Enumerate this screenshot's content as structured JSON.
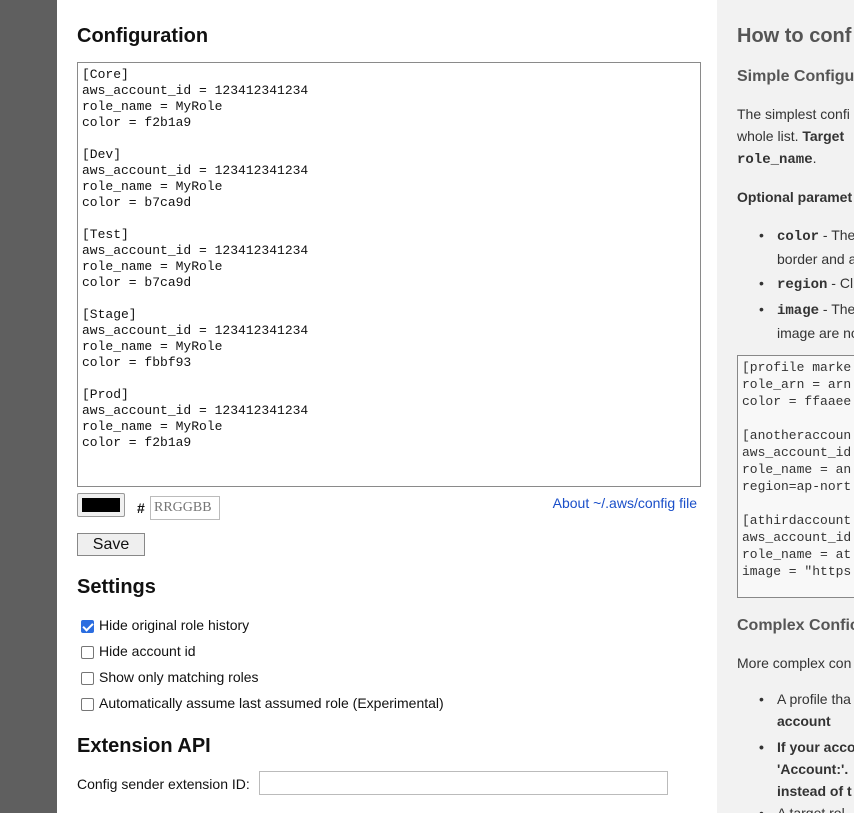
{
  "config": {
    "heading": "Configuration",
    "text": "[Core]\naws_account_id = 123412341234\nrole_name = MyRole\ncolor = f2b1a9\n\n[Dev]\naws_account_id = 123412341234\nrole_name = MyRole\ncolor = b7ca9d\n\n[Test]\naws_account_id = 123412341234\nrole_name = MyRole\ncolor = b7ca9d\n\n[Stage]\naws_account_id = 123412341234\nrole_name = MyRole\ncolor = fbbf93\n\n[Prod]\naws_account_id = 123412341234\nrole_name = MyRole\ncolor = f2b1a9",
    "color_value": "#000000",
    "hash": "#",
    "hex_placeholder": "RRGGBB",
    "about_link": "About ~/.aws/config file",
    "save_label": "Save"
  },
  "settings": {
    "heading": "Settings",
    "items": [
      {
        "label": "Hide original role history",
        "checked": true
      },
      {
        "label": "Hide account id",
        "checked": false
      },
      {
        "label": "Show only matching roles",
        "checked": false
      },
      {
        "label": "Automatically assume last assumed role (Experimental)",
        "checked": false
      }
    ]
  },
  "api": {
    "heading": "Extension API",
    "sender_label": "Config sender extension ID:"
  },
  "help": {
    "heading": "How to conf",
    "simple_heading": "Simple Configu",
    "simple_p_line1": "The simplest confi",
    "simple_p_line2_a": "whole list.",
    "simple_p_line2_b": "Target",
    "simple_p_line3_code": "role_name",
    "simple_p_line3_end": ".",
    "optional_heading": "Optional paramet",
    "optional_items": [
      {
        "code": "color",
        "text": " - The",
        "line2": "border and a"
      },
      {
        "code": "region",
        "text": " - Cl"
      },
      {
        "code": "image",
        "text": " - The",
        "line2": "image are no"
      }
    ],
    "example_code": "[profile marke\nrole_arn = arn\ncolor = ffaaee\n\n[anotheraccoun\naws_account_id\nrole_name = an\nregion=ap-nort\n\n[athirdaccount\naws_account_id\nrole_name = at\nimage = \"https",
    "complex_heading": "Complex Confic",
    "complex_p": "More complex con",
    "complex_items": [
      {
        "line1": "A profile tha",
        "line2_bold": "account"
      },
      {
        "line1_bold": "If your acco",
        "line2_bold": "'Account:'.",
        "line3_bold": "instead of t"
      },
      {
        "line1": "A target rol"
      }
    ]
  }
}
